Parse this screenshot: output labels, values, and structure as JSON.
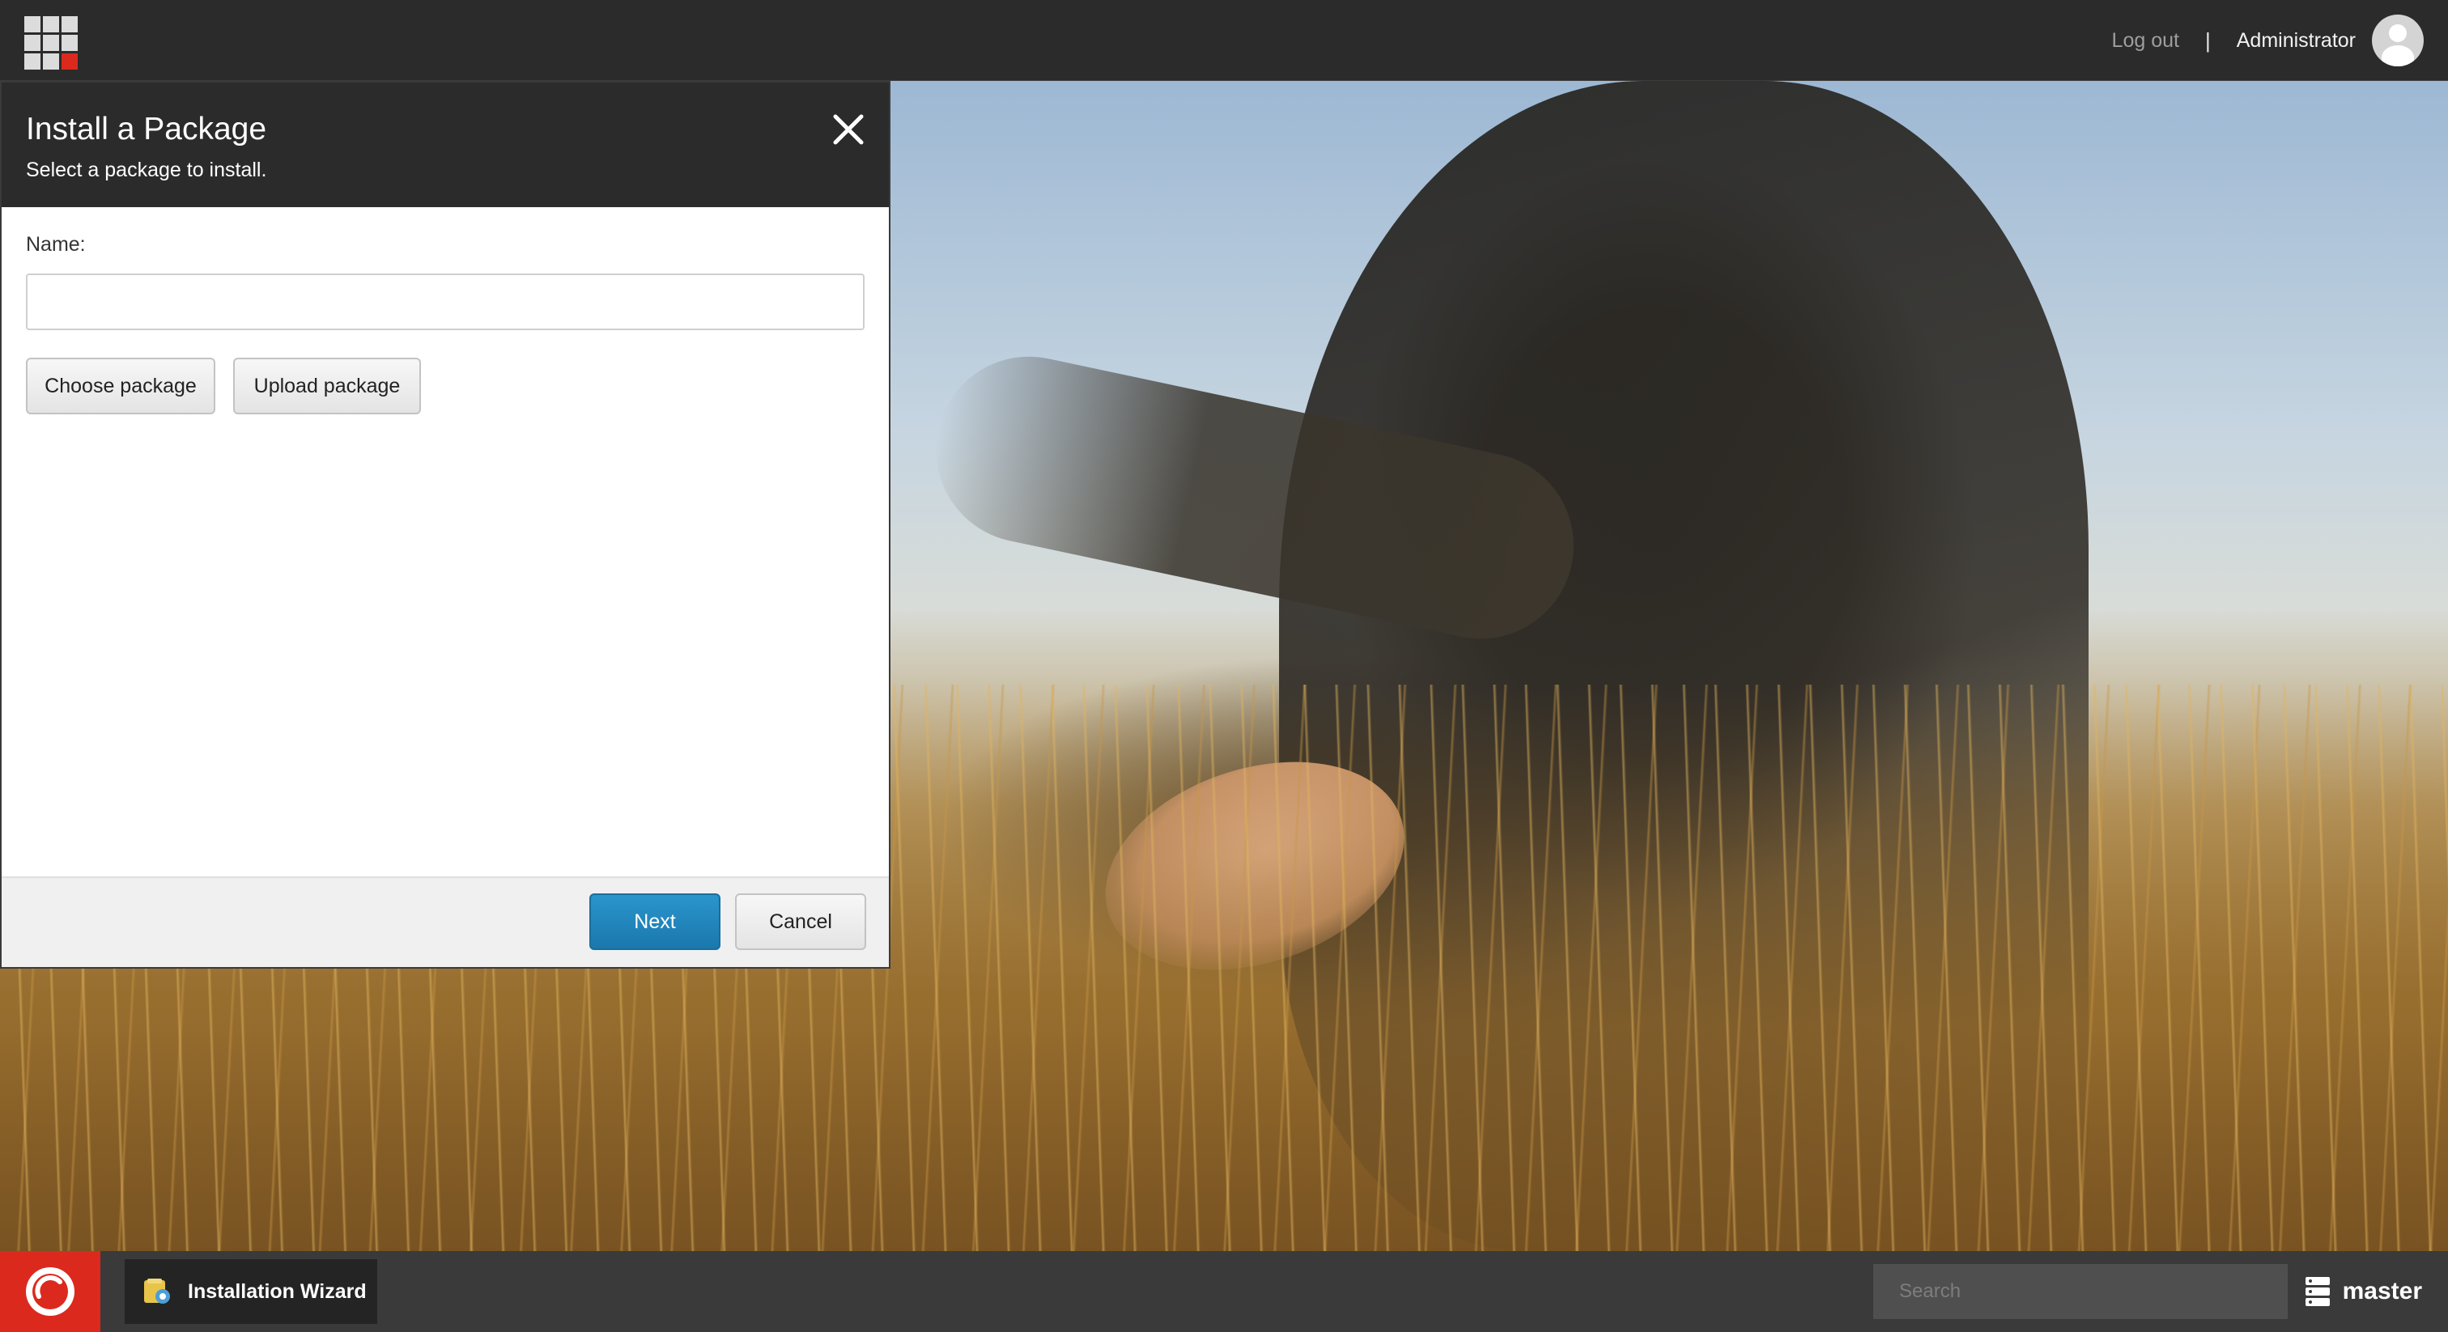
{
  "topbar": {
    "logout_label": "Log out",
    "separator": "|",
    "user_name": "Administrator"
  },
  "dialog": {
    "title": "Install a Package",
    "subtitle": "Select a package to install.",
    "name_label": "Name:",
    "name_value": "",
    "choose_label": "Choose package",
    "upload_label": "Upload package",
    "next_label": "Next",
    "cancel_label": "Cancel"
  },
  "taskbar": {
    "open_app_label": "Installation Wizard",
    "search_placeholder": "Search",
    "database_label": "master"
  },
  "colors": {
    "accent_red": "#dc291e",
    "primary_blue": "#1a78ad",
    "dark_bar": "#2b2b2b"
  },
  "icons": {
    "launcher": "grid-icon",
    "user": "avatar-icon",
    "close": "close-icon",
    "start": "start-logo-icon",
    "task": "wizard-icon",
    "database": "database-icon"
  }
}
